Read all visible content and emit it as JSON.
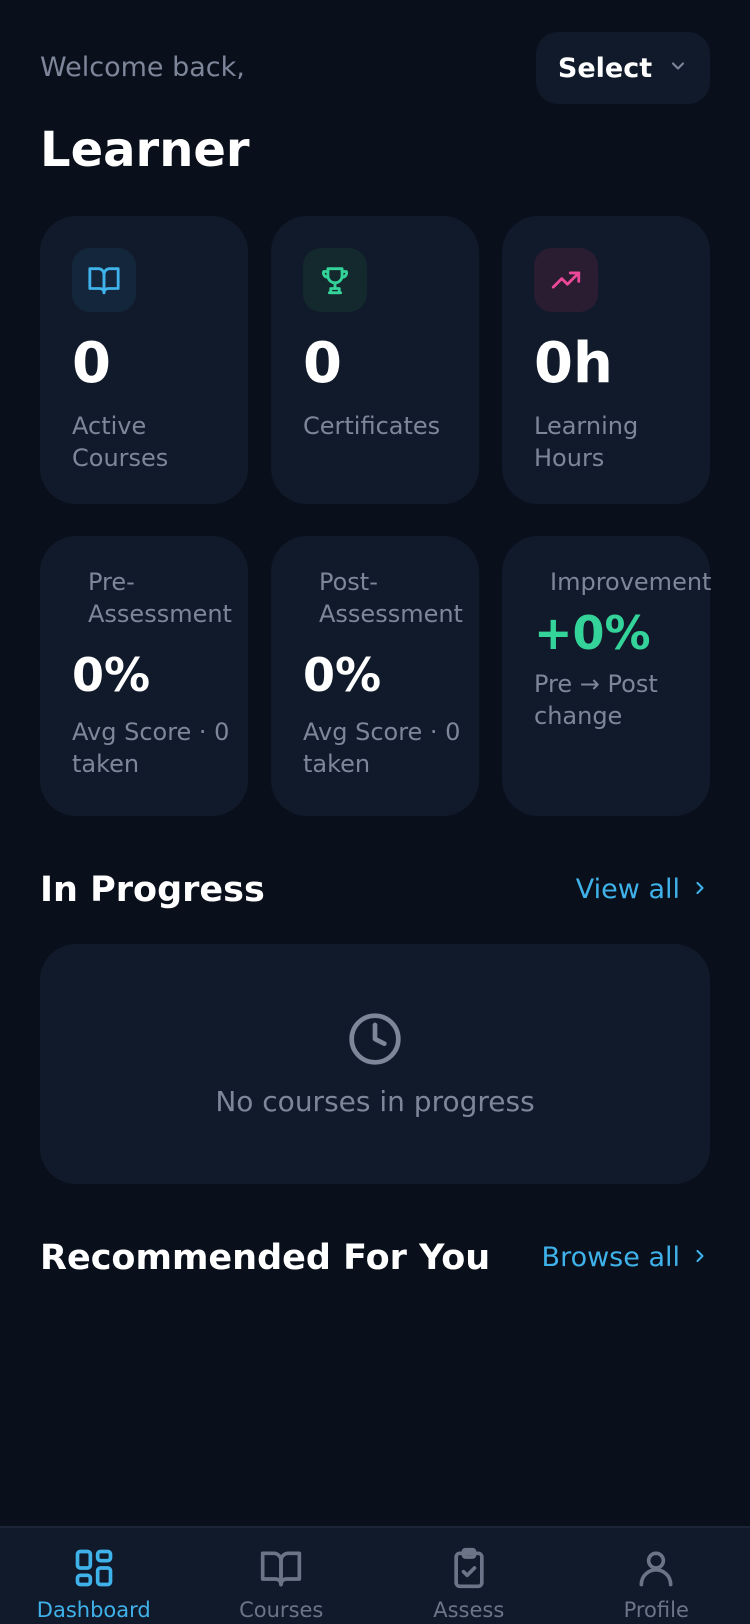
{
  "header": {
    "welcome": "Welcome back,",
    "user_name": "Learner",
    "select_label": "Select"
  },
  "stats": [
    {
      "value": "0",
      "label": "Active Courses",
      "icon": "book-open-icon",
      "color": "#3fb2ea"
    },
    {
      "value": "0",
      "label": "Certificates",
      "icon": "trophy-icon",
      "color": "#34d399"
    },
    {
      "value": "0h",
      "label": "Learning Hours",
      "icon": "trending-up-icon",
      "color": "#ec4899"
    }
  ],
  "assessments": [
    {
      "label": "Pre-Assessment",
      "value": "0%",
      "sub": "Avg Score · 0 taken"
    },
    {
      "label": "Post-Assessment",
      "value": "0%",
      "sub": "Avg Score · 0 taken"
    },
    {
      "label": "Improvement",
      "value": "+0%",
      "sub": "Pre → Post change",
      "color": "#34d399"
    }
  ],
  "in_progress": {
    "title": "In Progress",
    "link": "View all",
    "empty_text": "No courses in progress"
  },
  "recommended": {
    "title": "Recommended For You",
    "link": "Browse all"
  },
  "nav": [
    {
      "label": "Dashboard",
      "icon": "grid-icon",
      "active": true
    },
    {
      "label": "Courses",
      "icon": "book-open-icon",
      "active": false
    },
    {
      "label": "Assess",
      "icon": "clipboard-check-icon",
      "active": false
    },
    {
      "label": "Profile",
      "icon": "user-icon",
      "active": false
    }
  ],
  "colors": {
    "background": "#0a0f1c",
    "card": "#111a2b",
    "accent": "#3fb2ea",
    "success": "#34d399",
    "pink": "#ec4899",
    "muted": "#7d8799"
  }
}
